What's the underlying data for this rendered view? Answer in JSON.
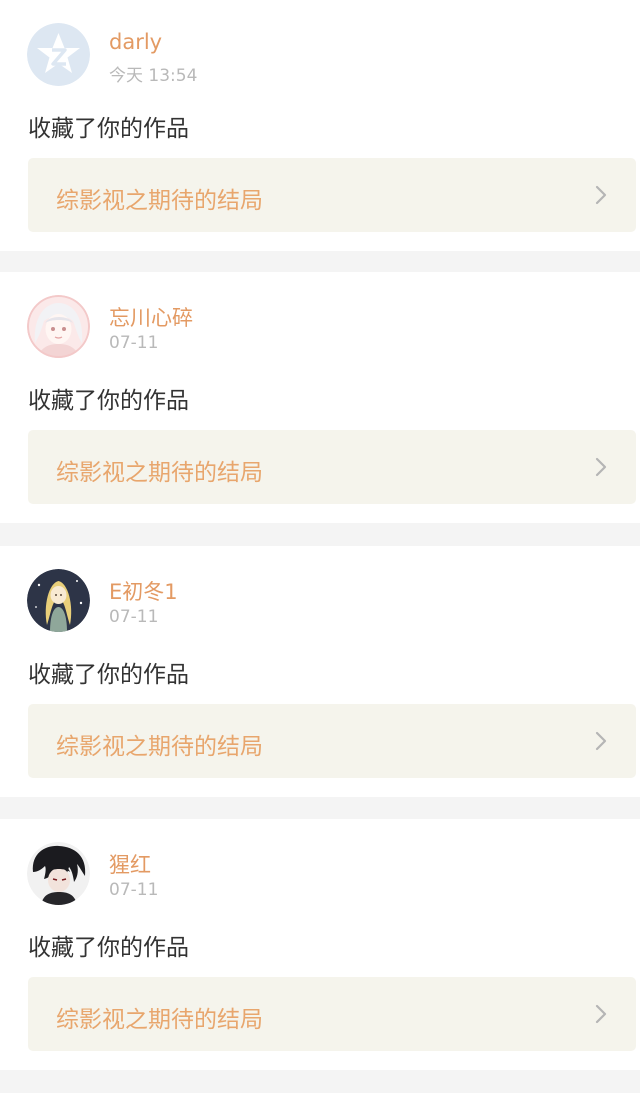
{
  "items": [
    {
      "username": "darly",
      "time": "今天 13:54",
      "action": "收藏了你的作品",
      "work_title": "综影视之期待的结局",
      "avatar_icon": "qzone-star-avatar-icon"
    },
    {
      "username": "忘川心碎",
      "time": "07-11",
      "action": "收藏了你的作品",
      "work_title": "综影视之期待的结局",
      "avatar_icon": "anime-girl-avatar-icon"
    },
    {
      "username": "E初冬1",
      "time": "07-11",
      "action": "收藏了你的作品",
      "work_title": "综影视之期待的结局",
      "avatar_icon": "anime-blonde-girl-avatar-icon"
    },
    {
      "username": "猩红",
      "time": "07-11",
      "action": "收藏了你的作品",
      "work_title": "综影视之期待的结局",
      "avatar_icon": "anime-dark-hair-avatar-icon"
    }
  ],
  "colors": {
    "username": "#e39a63",
    "work_title": "#e8a66d",
    "timestamp": "#b9b9b9",
    "link_card_bg": "#f5f4ec",
    "separator": "#f4f4f4"
  }
}
